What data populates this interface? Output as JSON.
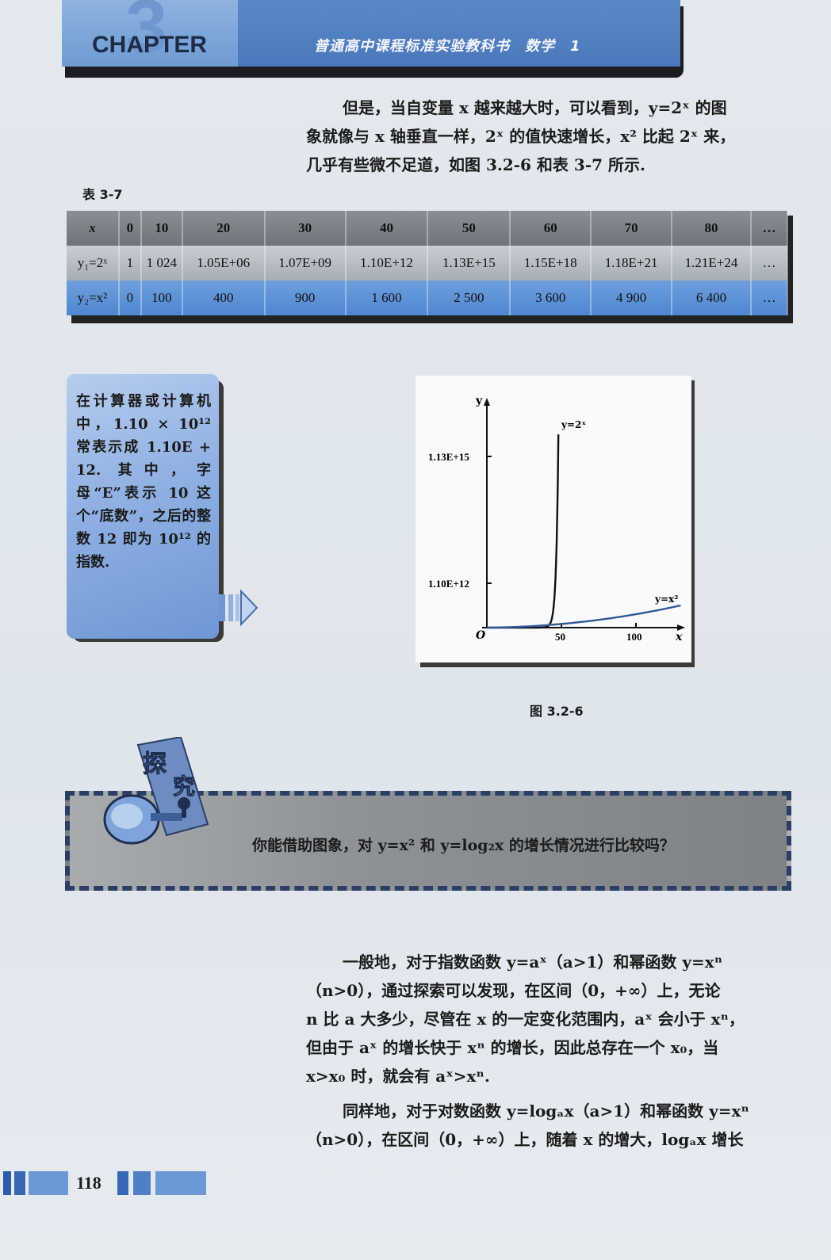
{
  "header": {
    "chapter_number": "3",
    "chapter_word": "CHAPTER",
    "book_title": "普通高中课程标准实验教科书　数学　1"
  },
  "intro_paragraph": {
    "line1": "但是，当自变量 x 越来越大时，可以看到，y=2ˣ 的图",
    "line2": "象就像与 x 轴垂直一样，2ˣ 的值快速增长，x² 比起 2ˣ 来，",
    "line3": "几乎有些微不足道，如图 3.2-6 和表 3-7 所示."
  },
  "table": {
    "caption": "表 3-7",
    "header_label": "x",
    "columns": [
      "0",
      "10",
      "20",
      "30",
      "40",
      "50",
      "60",
      "70",
      "80",
      "…"
    ],
    "rows": [
      {
        "label": "y₁=2ˣ",
        "values": [
          "1",
          "1 024",
          "1.05E+06",
          "1.07E+09",
          "1.10E+12",
          "1.13E+15",
          "1.15E+18",
          "1.18E+21",
          "1.21E+24",
          "…"
        ]
      },
      {
        "label": "y₂=x²",
        "values": [
          "0",
          "100",
          "400",
          "900",
          "1 600",
          "2 500",
          "3 600",
          "4 900",
          "6 400",
          "…"
        ]
      }
    ]
  },
  "side_note": {
    "text": "在计算器或计算机中，1.10 × 10¹² 常表示成 1.10E + 12. 其中，字母“E”表示 10 这个“底数”，之后的整数 12 即为 10¹² 的指数."
  },
  "figure": {
    "caption": "图 3.2-6",
    "chart_data": {
      "type": "line",
      "xlabel": "x",
      "ylabel": "y",
      "origin_label": "O",
      "x_ticks": [
        "50",
        "100"
      ],
      "y_ticks": [
        "1.10E+12",
        "1.13E+15"
      ],
      "series": [
        {
          "name": "y=2ˣ",
          "x": [
            0,
            20,
            30,
            35,
            40,
            45,
            50
          ],
          "y": [
            1,
            1048576,
            1073741824,
            34359738368,
            1099511627776,
            35184372088832,
            1125899906842624
          ]
        },
        {
          "name": "y=x²",
          "x": [
            0,
            50,
            100,
            130
          ],
          "y": [
            0,
            2500,
            10000,
            16900
          ]
        }
      ]
    }
  },
  "explore": {
    "icon_text_1": "探",
    "icon_text_2": "究",
    "question": "你能借助图象，对 y=x² 和 y=log₂x 的增长情况进行比较吗？"
  },
  "body_paragraphs": {
    "p1_line1": "一般地，对于指数函数 y=aˣ（a>1）和幂函数 y=xⁿ",
    "p1_line2": "（n>0），通过探索可以发现，在区间（0，+∞）上，无论",
    "p1_line3": "n 比 a 大多少，尽管在 x 的一定变化范围内，aˣ 会小于 xⁿ，",
    "p1_line4": "但由于 aˣ 的增长快于 xⁿ 的增长，因此总存在一个 x₀，当",
    "p1_line5": "x>x₀ 时，就会有 aˣ>xⁿ.",
    "p2_line1": "同样地，对于对数函数 y=logₐx（a>1）和幂函数 y=xⁿ",
    "p2_line2": "（n>0），在区间（0，+∞）上，随着 x 的增大，logₐx 增长"
  },
  "footer": {
    "page_number": "118"
  },
  "colors": {
    "header_blue": "#4a78bc",
    "table_head_gray": "#7a7f86",
    "table_pow_blue": "#5a8fd6",
    "note_blue": "#8fb0e2",
    "explore_border": "#2b3e66"
  }
}
